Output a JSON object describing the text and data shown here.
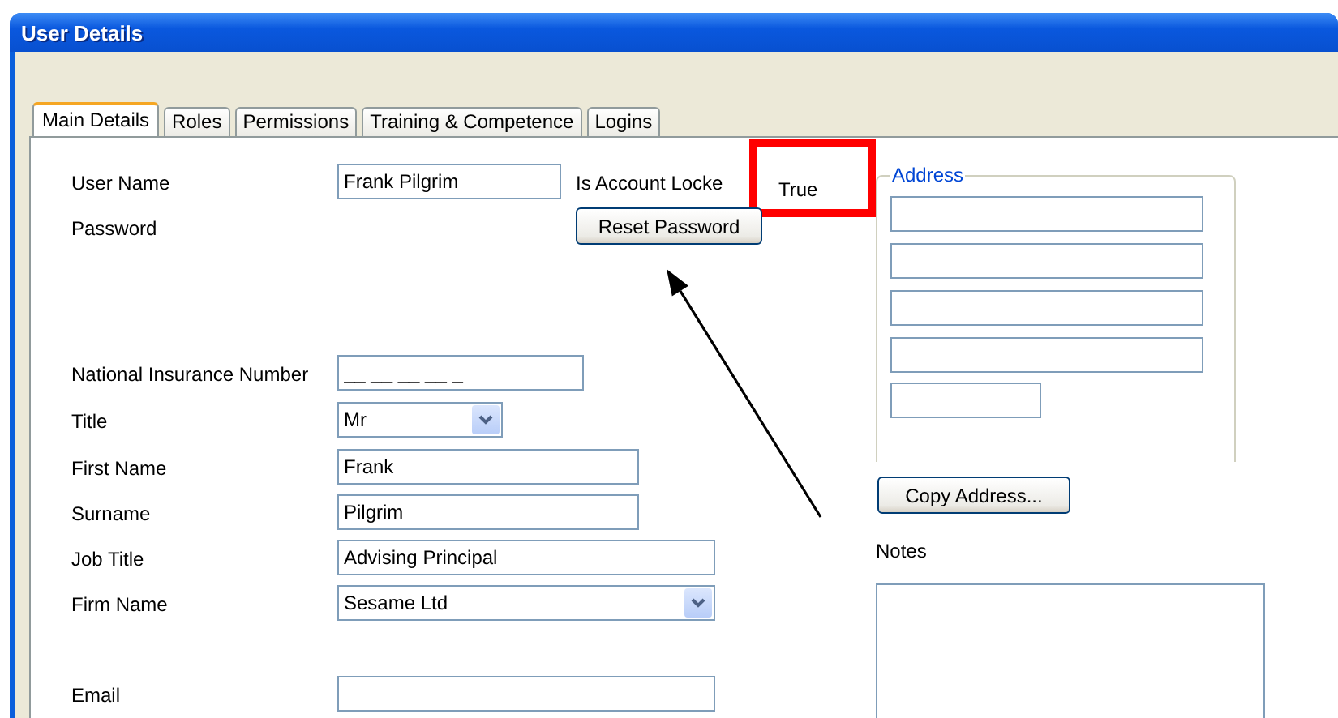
{
  "window": {
    "title": "User Details"
  },
  "tabs": [
    {
      "label": "Main Details",
      "selected": true
    },
    {
      "label": "Roles",
      "selected": false
    },
    {
      "label": "Permissions",
      "selected": false
    },
    {
      "label": "Training & Competence",
      "selected": false
    },
    {
      "label": "Logins",
      "selected": false
    }
  ],
  "account": {
    "user_name_label": "User Name",
    "user_name": "Frank Pilgrim",
    "locked_label": "Is Account Locke",
    "locked_value": "True",
    "password_label": "Password",
    "reset_button": "Reset Password"
  },
  "fields": [
    {
      "label": "National Insurance Number",
      "kind": "text",
      "value": "__ __ __ __ _"
    },
    {
      "label": "Title",
      "kind": "combo",
      "value": "Mr"
    },
    {
      "label": "First Name",
      "kind": "text",
      "value": "Frank"
    },
    {
      "label": "Surname",
      "kind": "text",
      "value": "Pilgrim"
    },
    {
      "label": "Job Title",
      "kind": "text",
      "value": "Advising Principal"
    },
    {
      "label": "Firm Name",
      "kind": "combo",
      "value": "Sesame Ltd"
    },
    {
      "label": "Email",
      "kind": "text"
    }
  ],
  "address": {
    "title": "Address",
    "lines": [
      {
        "kind": "long"
      },
      {
        "kind": "long"
      },
      {
        "kind": "long"
      },
      {
        "kind": "long"
      },
      {
        "kind": "short"
      }
    ],
    "copy_button": "Copy Address..."
  },
  "notes": {
    "label": "Notes"
  }
}
